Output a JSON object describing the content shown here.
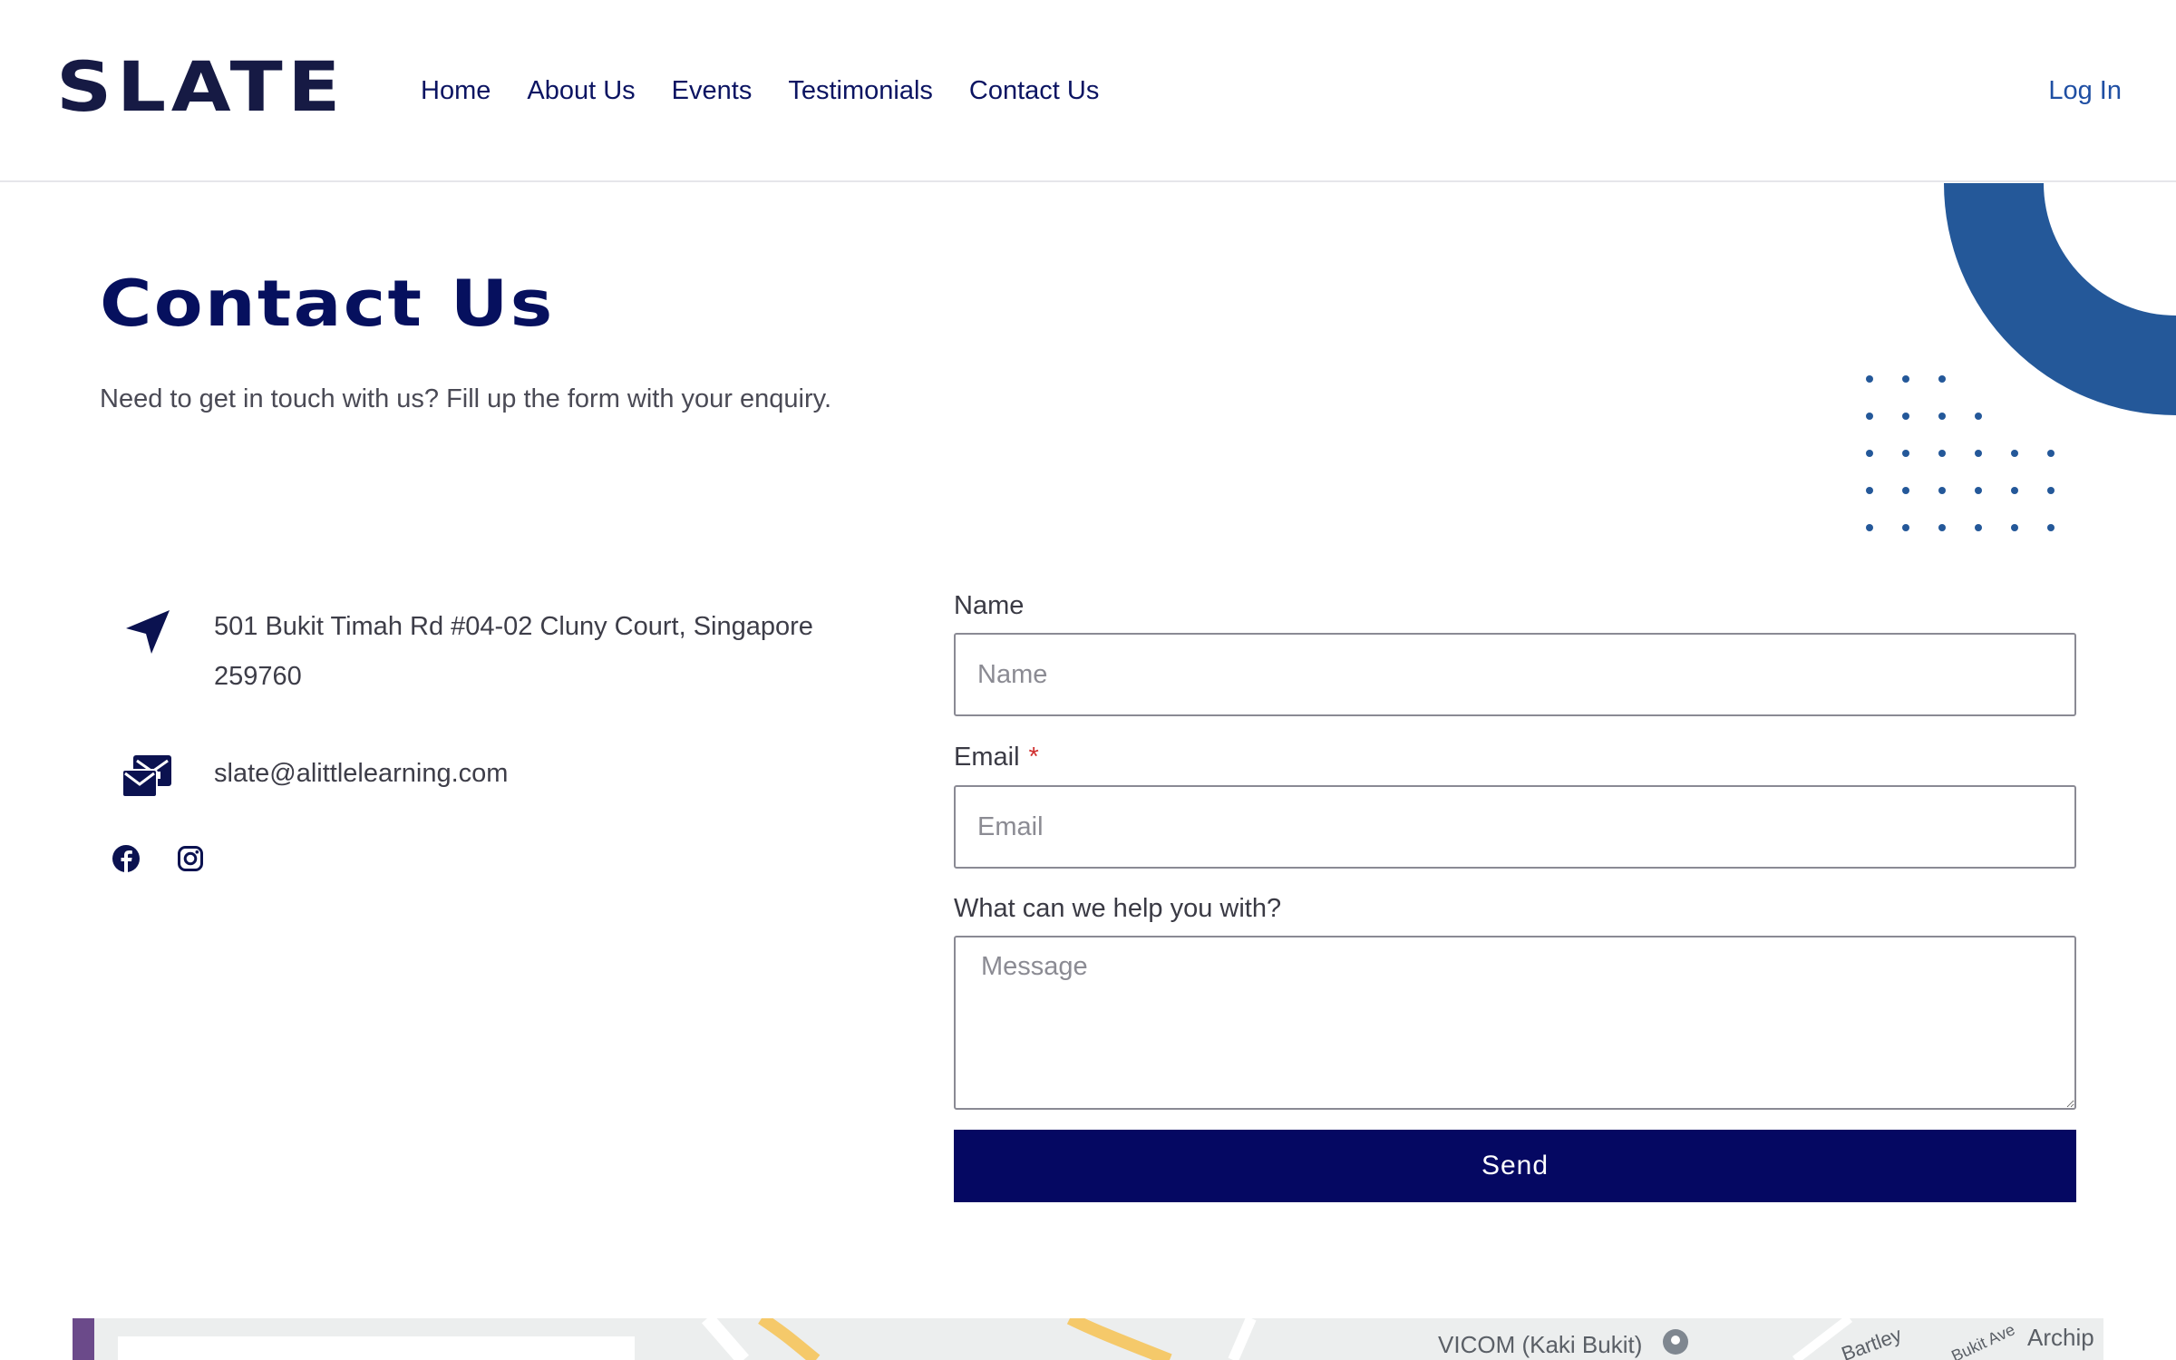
{
  "header": {
    "logo": "SLATE",
    "nav": [
      "Home",
      "About Us",
      "Events",
      "Testimonials",
      "Contact Us"
    ],
    "login": "Log In"
  },
  "hero": {
    "title": "Contact Us",
    "subtitle": "Need to get in touch with us? Fill up the form with your enquiry."
  },
  "contact": {
    "address_line1": "501 Bukit Timah Rd #04-02 Cluny Court, Singapore",
    "address_line2": "259760",
    "email": "slate@alittlelearning.com",
    "icons": {
      "address": "location-arrow-icon",
      "email": "mail-envelopes-icon",
      "facebook": "facebook-icon",
      "instagram": "instagram-icon"
    }
  },
  "form": {
    "name_label": "Name",
    "name_placeholder": "Name",
    "email_label": "Email",
    "email_required_mark": "*",
    "email_placeholder": "Email",
    "message_label": "What can we help you with?",
    "message_placeholder": "Message",
    "send_label": "Send"
  },
  "map": {
    "labels": [
      "VICOM (Kaki Bukit)",
      "Bartley",
      "Archip",
      "Bukit Ave"
    ]
  },
  "colors": {
    "brand_navy": "#050862",
    "link_blue": "#0b1462",
    "accent_blue": "#245899",
    "required_red": "#d03030"
  }
}
